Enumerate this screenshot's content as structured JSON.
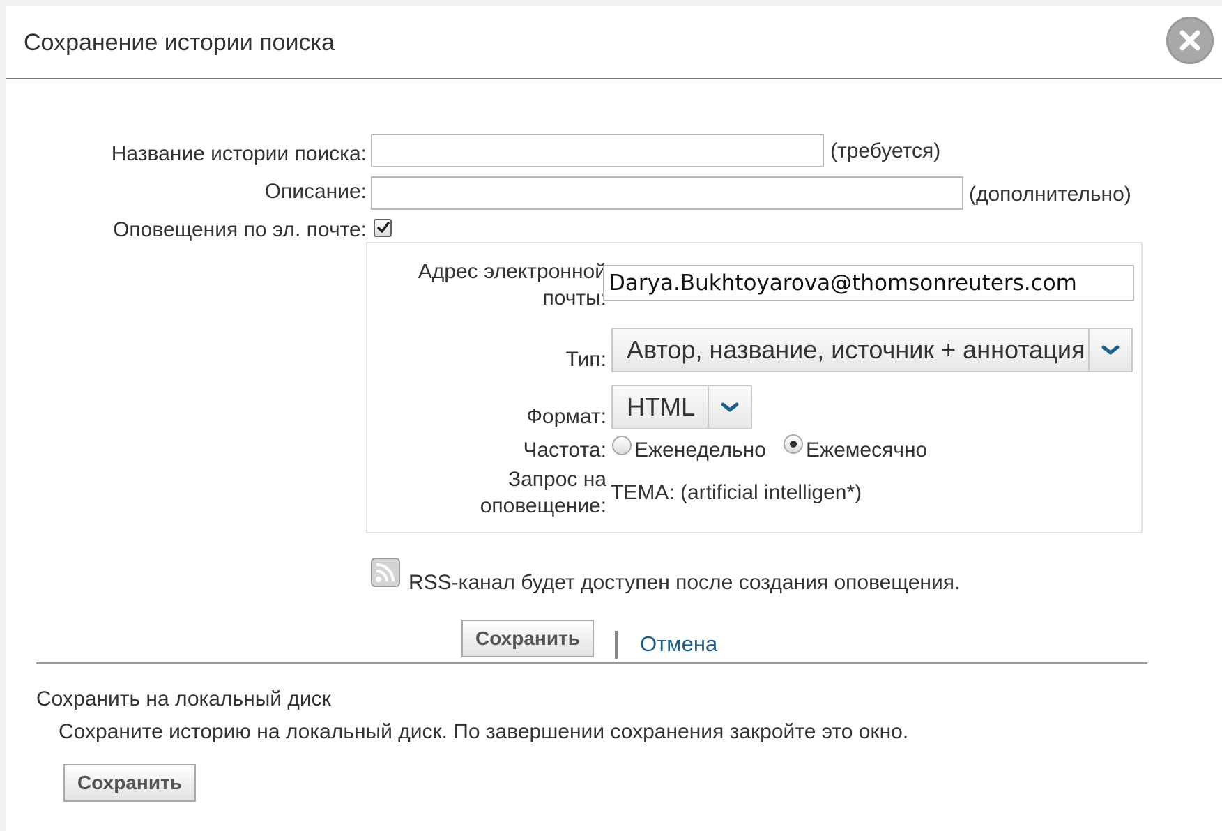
{
  "dialog": {
    "title": "Сохранение истории поиска",
    "close_icon": "close-icon"
  },
  "form": {
    "name_label": "Название истории поиска:",
    "name_value": "",
    "name_hint": "(требуется)",
    "description_label": "Описание:",
    "description_value": "",
    "description_hint": "(дополнительно)",
    "email_alerts_label": "Оповещения по эл. почте:",
    "email_alerts_checked": true
  },
  "alert": {
    "email_label_line1": "Адрес электронной",
    "email_label_line2": "почты:",
    "email_value": "Darya.Bukhtoyarova@thomsonreuters.com",
    "type_label": "Тип:",
    "type_value": "Автор, название, источник + аннотация",
    "format_label": "Формат:",
    "format_value": "HTML",
    "frequency_label": "Частота:",
    "frequency_options": [
      "Еженедельно",
      "Ежемесячно"
    ],
    "frequency_selected": "Ежемесячно",
    "query_label_line1": "Запрос на",
    "query_label_line2": "оповещение:",
    "query_value": "ТЕМА: (artificial intelligen*)"
  },
  "rss": {
    "icon": "rss-icon",
    "text": "RSS-канал будет доступен после создания оповещения."
  },
  "actions": {
    "save_label": "Сохранить",
    "cancel_label": "Отмена"
  },
  "local": {
    "title": "Сохранить на локальный диск",
    "description": "Сохраните историю на локальный диск. По завершении сохранения закройте это окно.",
    "save_label": "Сохранить"
  },
  "colors": {
    "link": "#1d5f8a",
    "chevron": "#1d5f8a"
  }
}
